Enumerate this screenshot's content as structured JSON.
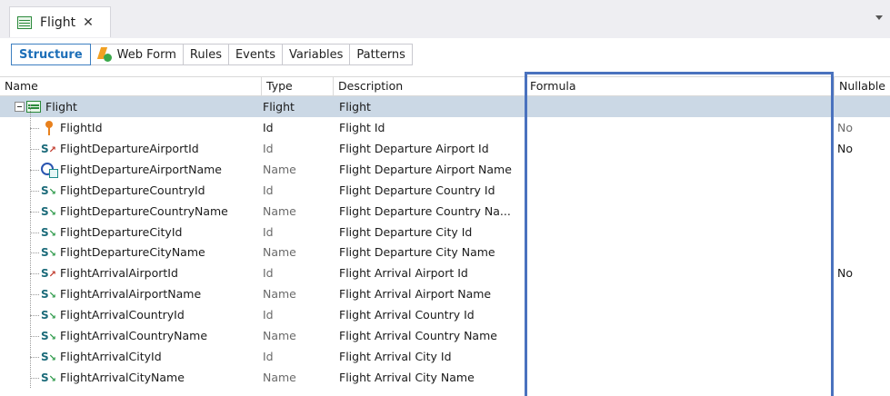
{
  "tab": {
    "title": "Flight",
    "close": "✕"
  },
  "subtabs": [
    "Structure",
    "Web Form",
    "Rules",
    "Events",
    "Variables",
    "Patterns"
  ],
  "columns": {
    "name": "Name",
    "type": "Type",
    "description": "Description",
    "formula": "Formula",
    "nullable": "Nullable"
  },
  "root": {
    "name": "Flight",
    "type": "Flight",
    "description": "Flight"
  },
  "rows": [
    {
      "name": "FlightId",
      "type": "Id",
      "description": "Flight Id",
      "nullable": "No",
      "icon": "key-icon",
      "type_style": "normal",
      "null_style": "muted"
    },
    {
      "name": "FlightDepartureAirportId",
      "type": "Id",
      "description": "Flight Departure Airport Id",
      "nullable": "No",
      "icon": "subtype-key-icon",
      "type_style": "muted",
      "null_style": "normal"
    },
    {
      "name": "FlightDepartureAirportName",
      "type": "Name",
      "description": "Flight Departure Airport Name",
      "nullable": "",
      "icon": "lookup-icon",
      "type_style": "muted",
      "null_style": "normal"
    },
    {
      "name": "FlightDepartureCountryId",
      "type": "Id",
      "description": "Flight Departure Country Id",
      "nullable": "",
      "icon": "subtype-icon",
      "type_style": "muted",
      "null_style": "normal"
    },
    {
      "name": "FlightDepartureCountryName",
      "type": "Name",
      "description": "Flight Departure Country Na...",
      "nullable": "",
      "icon": "subtype-icon",
      "type_style": "muted",
      "null_style": "normal"
    },
    {
      "name": "FlightDepartureCityId",
      "type": "Id",
      "description": "Flight Departure City Id",
      "nullable": "",
      "icon": "subtype-icon",
      "type_style": "muted",
      "null_style": "normal"
    },
    {
      "name": "FlightDepartureCityName",
      "type": "Name",
      "description": "Flight Departure City Name",
      "nullable": "",
      "icon": "subtype-icon",
      "type_style": "muted",
      "null_style": "normal"
    },
    {
      "name": "FlightArrivalAirportId",
      "type": "Id",
      "description": "Flight Arrival Airport Id",
      "nullable": "No",
      "icon": "subtype-key-icon",
      "type_style": "muted",
      "null_style": "normal"
    },
    {
      "name": "FlightArrivalAirportName",
      "type": "Name",
      "description": "Flight Arrival Airport Name",
      "nullable": "",
      "icon": "subtype-icon",
      "type_style": "muted",
      "null_style": "normal"
    },
    {
      "name": "FlightArrivalCountryId",
      "type": "Id",
      "description": "Flight Arrival Country Id",
      "nullable": "",
      "icon": "subtype-icon",
      "type_style": "muted",
      "null_style": "normal"
    },
    {
      "name": "FlightArrivalCountryName",
      "type": "Name",
      "description": "Flight Arrival Country Name",
      "nullable": "",
      "icon": "subtype-icon",
      "type_style": "muted",
      "null_style": "normal"
    },
    {
      "name": "FlightArrivalCityId",
      "type": "Id",
      "description": "Flight Arrival City Id",
      "nullable": "",
      "icon": "subtype-icon",
      "type_style": "muted",
      "null_style": "normal"
    },
    {
      "name": "FlightArrivalCityName",
      "type": "Name",
      "description": "Flight Arrival City Name",
      "nullable": "",
      "icon": "subtype-icon",
      "type_style": "muted",
      "null_style": "normal"
    }
  ],
  "colors": {
    "accent": "#1d6fb8",
    "highlight_box": "#4a72be",
    "selected_row": "#cbd8e5"
  }
}
